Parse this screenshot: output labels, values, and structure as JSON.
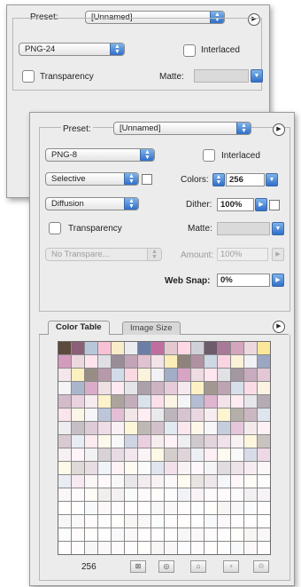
{
  "back_panel": {
    "preset_label": "Preset:",
    "preset_value": "[Unnamed]",
    "format": "PNG-24",
    "interlaced_label": "Interlaced",
    "transparency_label": "Transparency",
    "matte_label": "Matte:",
    "menu_icon": "flyout-menu-icon"
  },
  "front_panel": {
    "preset_label": "Preset:",
    "preset_value": "[Unnamed]",
    "format": "PNG-8",
    "interlaced_label": "Interlaced",
    "reduction": "Selective",
    "colors_label": "Colors:",
    "colors_value": "256",
    "dither_method": "Diffusion",
    "dither_label": "Dither:",
    "dither_value": "100%",
    "transparency_label": "Transparency",
    "matte_label": "Matte:",
    "transparency_dither": "No Transpare...",
    "amount_label": "Amount:",
    "amount_value": "100%",
    "websnap_label": "Web Snap:",
    "websnap_value": "0%"
  },
  "tabs": {
    "color_table": "Color Table",
    "image_size": "Image Size"
  },
  "color_table": {
    "color_count": "256",
    "palette": [
      "#5c4a3e",
      "#6d5a6a",
      "#6c7ea8",
      "#8c5f78",
      "#a87a98",
      "#c06ea0",
      "#b8c6da",
      "#d3a6be",
      "#e3c8cf",
      "#f7c2d3",
      "#edd8df",
      "#ffd8e6",
      "#f9ecc8",
      "#fbe79a",
      "#d0d0d8",
      "#ebebf0"
    ],
    "bottom_icons": [
      "eyedropper-icon",
      "web-shift-icon",
      "lock-icon",
      "new-color-icon",
      "trash-icon"
    ]
  },
  "colors": {
    "panel_bg": "#ececec",
    "select_accent": "#2f6fc8"
  }
}
